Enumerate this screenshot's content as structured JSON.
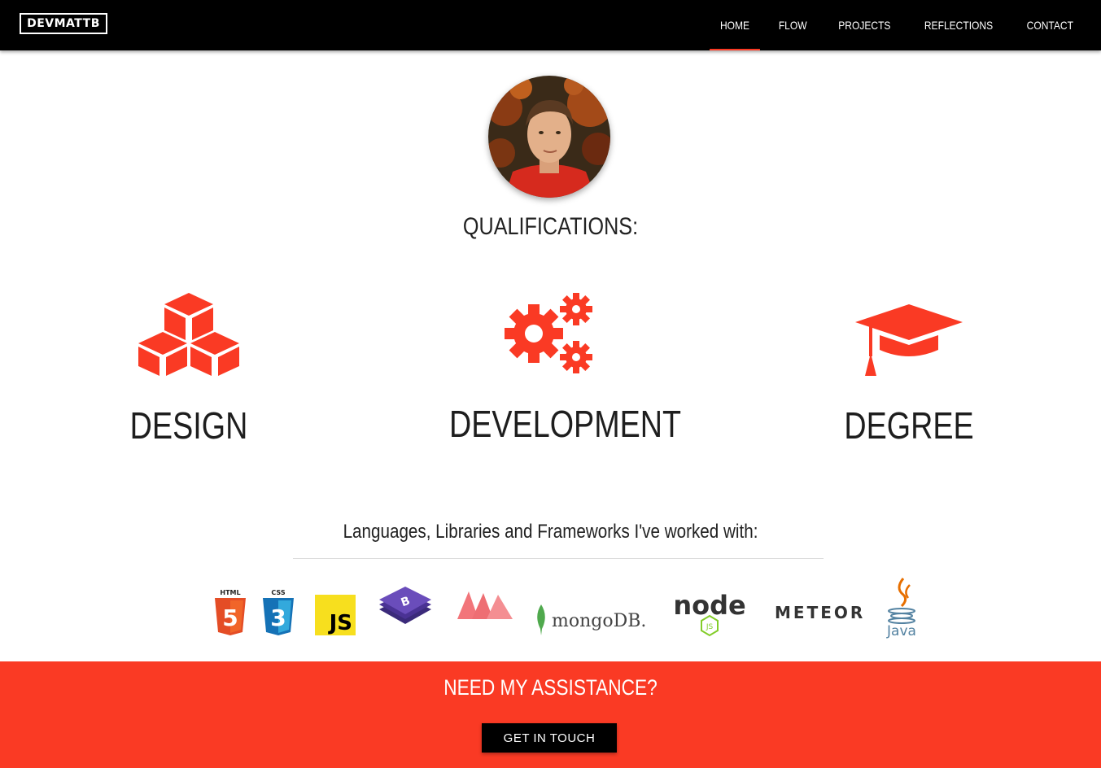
{
  "brand": "DEVMATTB",
  "nav": [
    "HOME",
    "FLOW",
    "PROJECTS",
    "REFLECTIONS",
    "CONTACT"
  ],
  "nav_active": "HOME",
  "accent_color": "#fa3a24",
  "qualifications_heading": "QUALIFICATIONS:",
  "qualifications": [
    {
      "label": "DESIGN",
      "icon": "cubes-icon"
    },
    {
      "label": "DEVELOPMENT",
      "icon": "gears-icon"
    },
    {
      "label": "DEGREE",
      "icon": "graduation-cap-icon"
    }
  ],
  "tech_heading": "Languages, Libraries and Frameworks I've worked with:",
  "tech_logos": {
    "html5": {
      "top": "HTML",
      "mark": "5"
    },
    "css3": {
      "top": "CSS",
      "mark": "3"
    },
    "js": "JS",
    "bootstrap": "B",
    "mongodb": "mongoDB.",
    "node": {
      "word": "node",
      "sub": "JS"
    },
    "meteor": "METEOR",
    "java": "Java"
  },
  "cta": {
    "title": "NEED MY ASSISTANCE?",
    "button": "GET IN TOUCH"
  }
}
